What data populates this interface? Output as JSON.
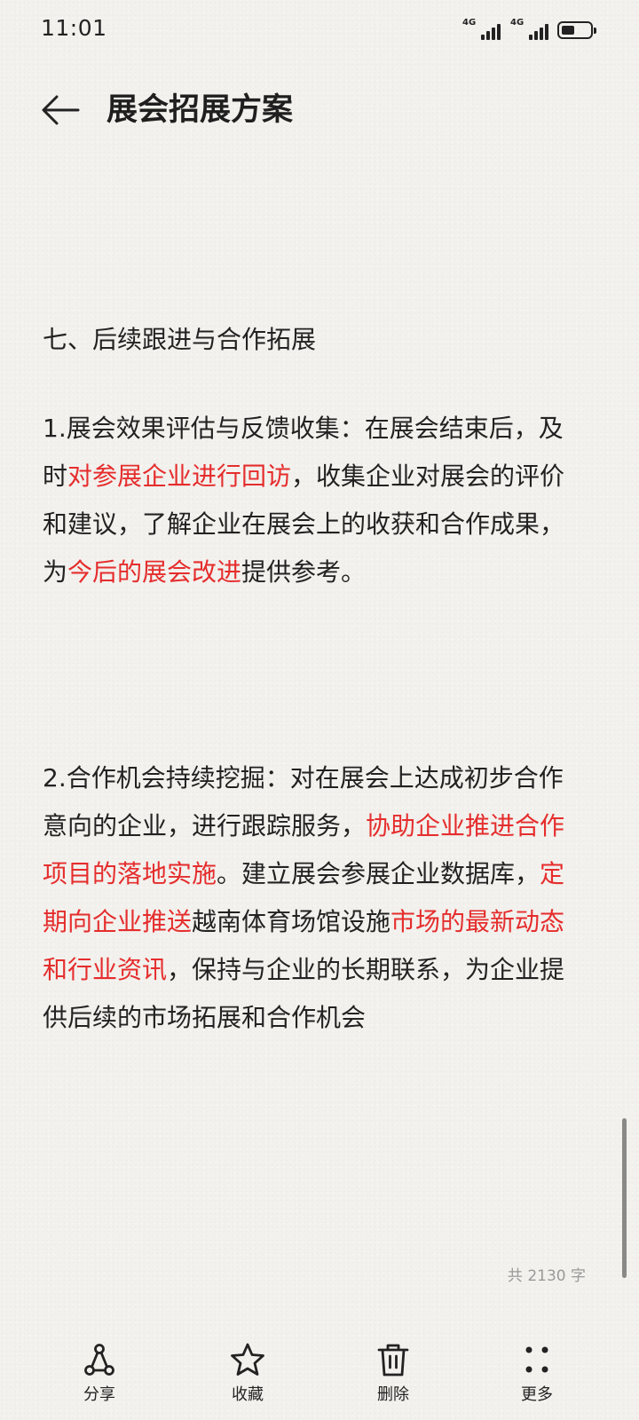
{
  "status_bar": {
    "time": "11:01",
    "signal_1_label": "4G",
    "signal_2_label": "4G",
    "battery_level": 0.45
  },
  "header": {
    "title": "展会招展方案",
    "back_icon": "arrow-left-icon"
  },
  "content": {
    "section_heading": "七、后续跟进与合作拓展",
    "paragraph_1": [
      {
        "text": "1.展会效果评估与反馈收集：在展会结束后，及时",
        "highlight": false
      },
      {
        "text": "对参展企业进行回访",
        "highlight": true
      },
      {
        "text": "，收集企业对展会的评价和建议，了解企业在展会上的收获和合作成果，为",
        "highlight": false
      },
      {
        "text": "今后的展会改进",
        "highlight": true
      },
      {
        "text": "提供参考。",
        "highlight": false
      }
    ],
    "paragraph_2": [
      {
        "text": "2.合作机会持续挖掘：对在展会上达成初步合作意向的企业，进行跟踪服务，",
        "highlight": false
      },
      {
        "text": "协助企业推进合作项目的落地实施",
        "highlight": true
      },
      {
        "text": "。建立展会参展企业数据库，",
        "highlight": false
      },
      {
        "text": "定期向企业推送",
        "highlight": true
      },
      {
        "text": "越南体育场馆设施",
        "highlight": false
      },
      {
        "text": "市场的最新动态和行业资讯",
        "highlight": true
      },
      {
        "text": "，保持与企业的长期联系，为企业提供后续的市场拓展和合作机会",
        "highlight": false
      }
    ],
    "highlight_color": "#e52d2d"
  },
  "word_count": "共 2130 字",
  "toolbar": {
    "share_label": "分享",
    "favorite_label": "收藏",
    "delete_label": "删除",
    "more_label": "更多",
    "share_icon": "share-icon",
    "favorite_icon": "star-icon",
    "delete_icon": "trash-icon",
    "more_icon": "more-dots-icon"
  },
  "scroll_position": 0.88
}
